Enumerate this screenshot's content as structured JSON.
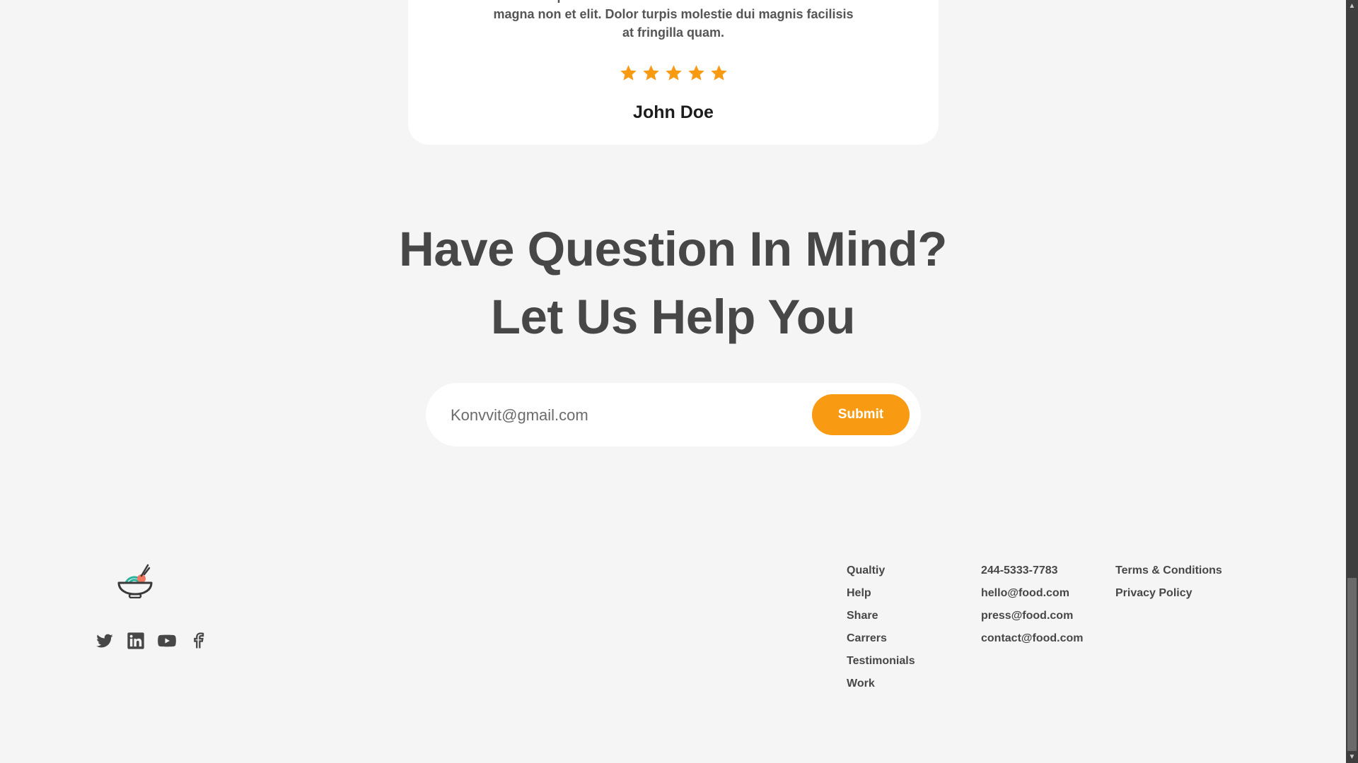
{
  "testimonial": {
    "quote": "Lorem ipsum dolor sit amet consectetur. Vel tincidunt magna non et elit. Dolor turpis molestie dui magnis facilisis at fringilla quam.",
    "rating": 5,
    "rating_max": 5,
    "star_color": "#f99b12",
    "reviewer": "John Doe"
  },
  "cta": {
    "heading_line1": "Have Question In Mind?",
    "heading_line2": "Let Us Help You"
  },
  "form": {
    "email_placeholder": "Konvvit@gmail.com",
    "submit_label": "Submit",
    "accent": "#f99b12"
  },
  "footer": {
    "logo_icon": "food-bowl-logo-icon",
    "social": [
      "twitter-icon",
      "linkedin-icon",
      "youtube-icon",
      "facebook-icon"
    ],
    "links_col1": [
      "Qualtiy",
      "Help",
      "Share",
      "Carrers",
      "Testimonials",
      "Work"
    ],
    "links_col2": [
      "244-5333-7783",
      "hello@food.com",
      "press@food.com",
      "contact@food.com"
    ],
    "links_col3": [
      "Terms & Conditions",
      "Privacy Policy"
    ]
  }
}
